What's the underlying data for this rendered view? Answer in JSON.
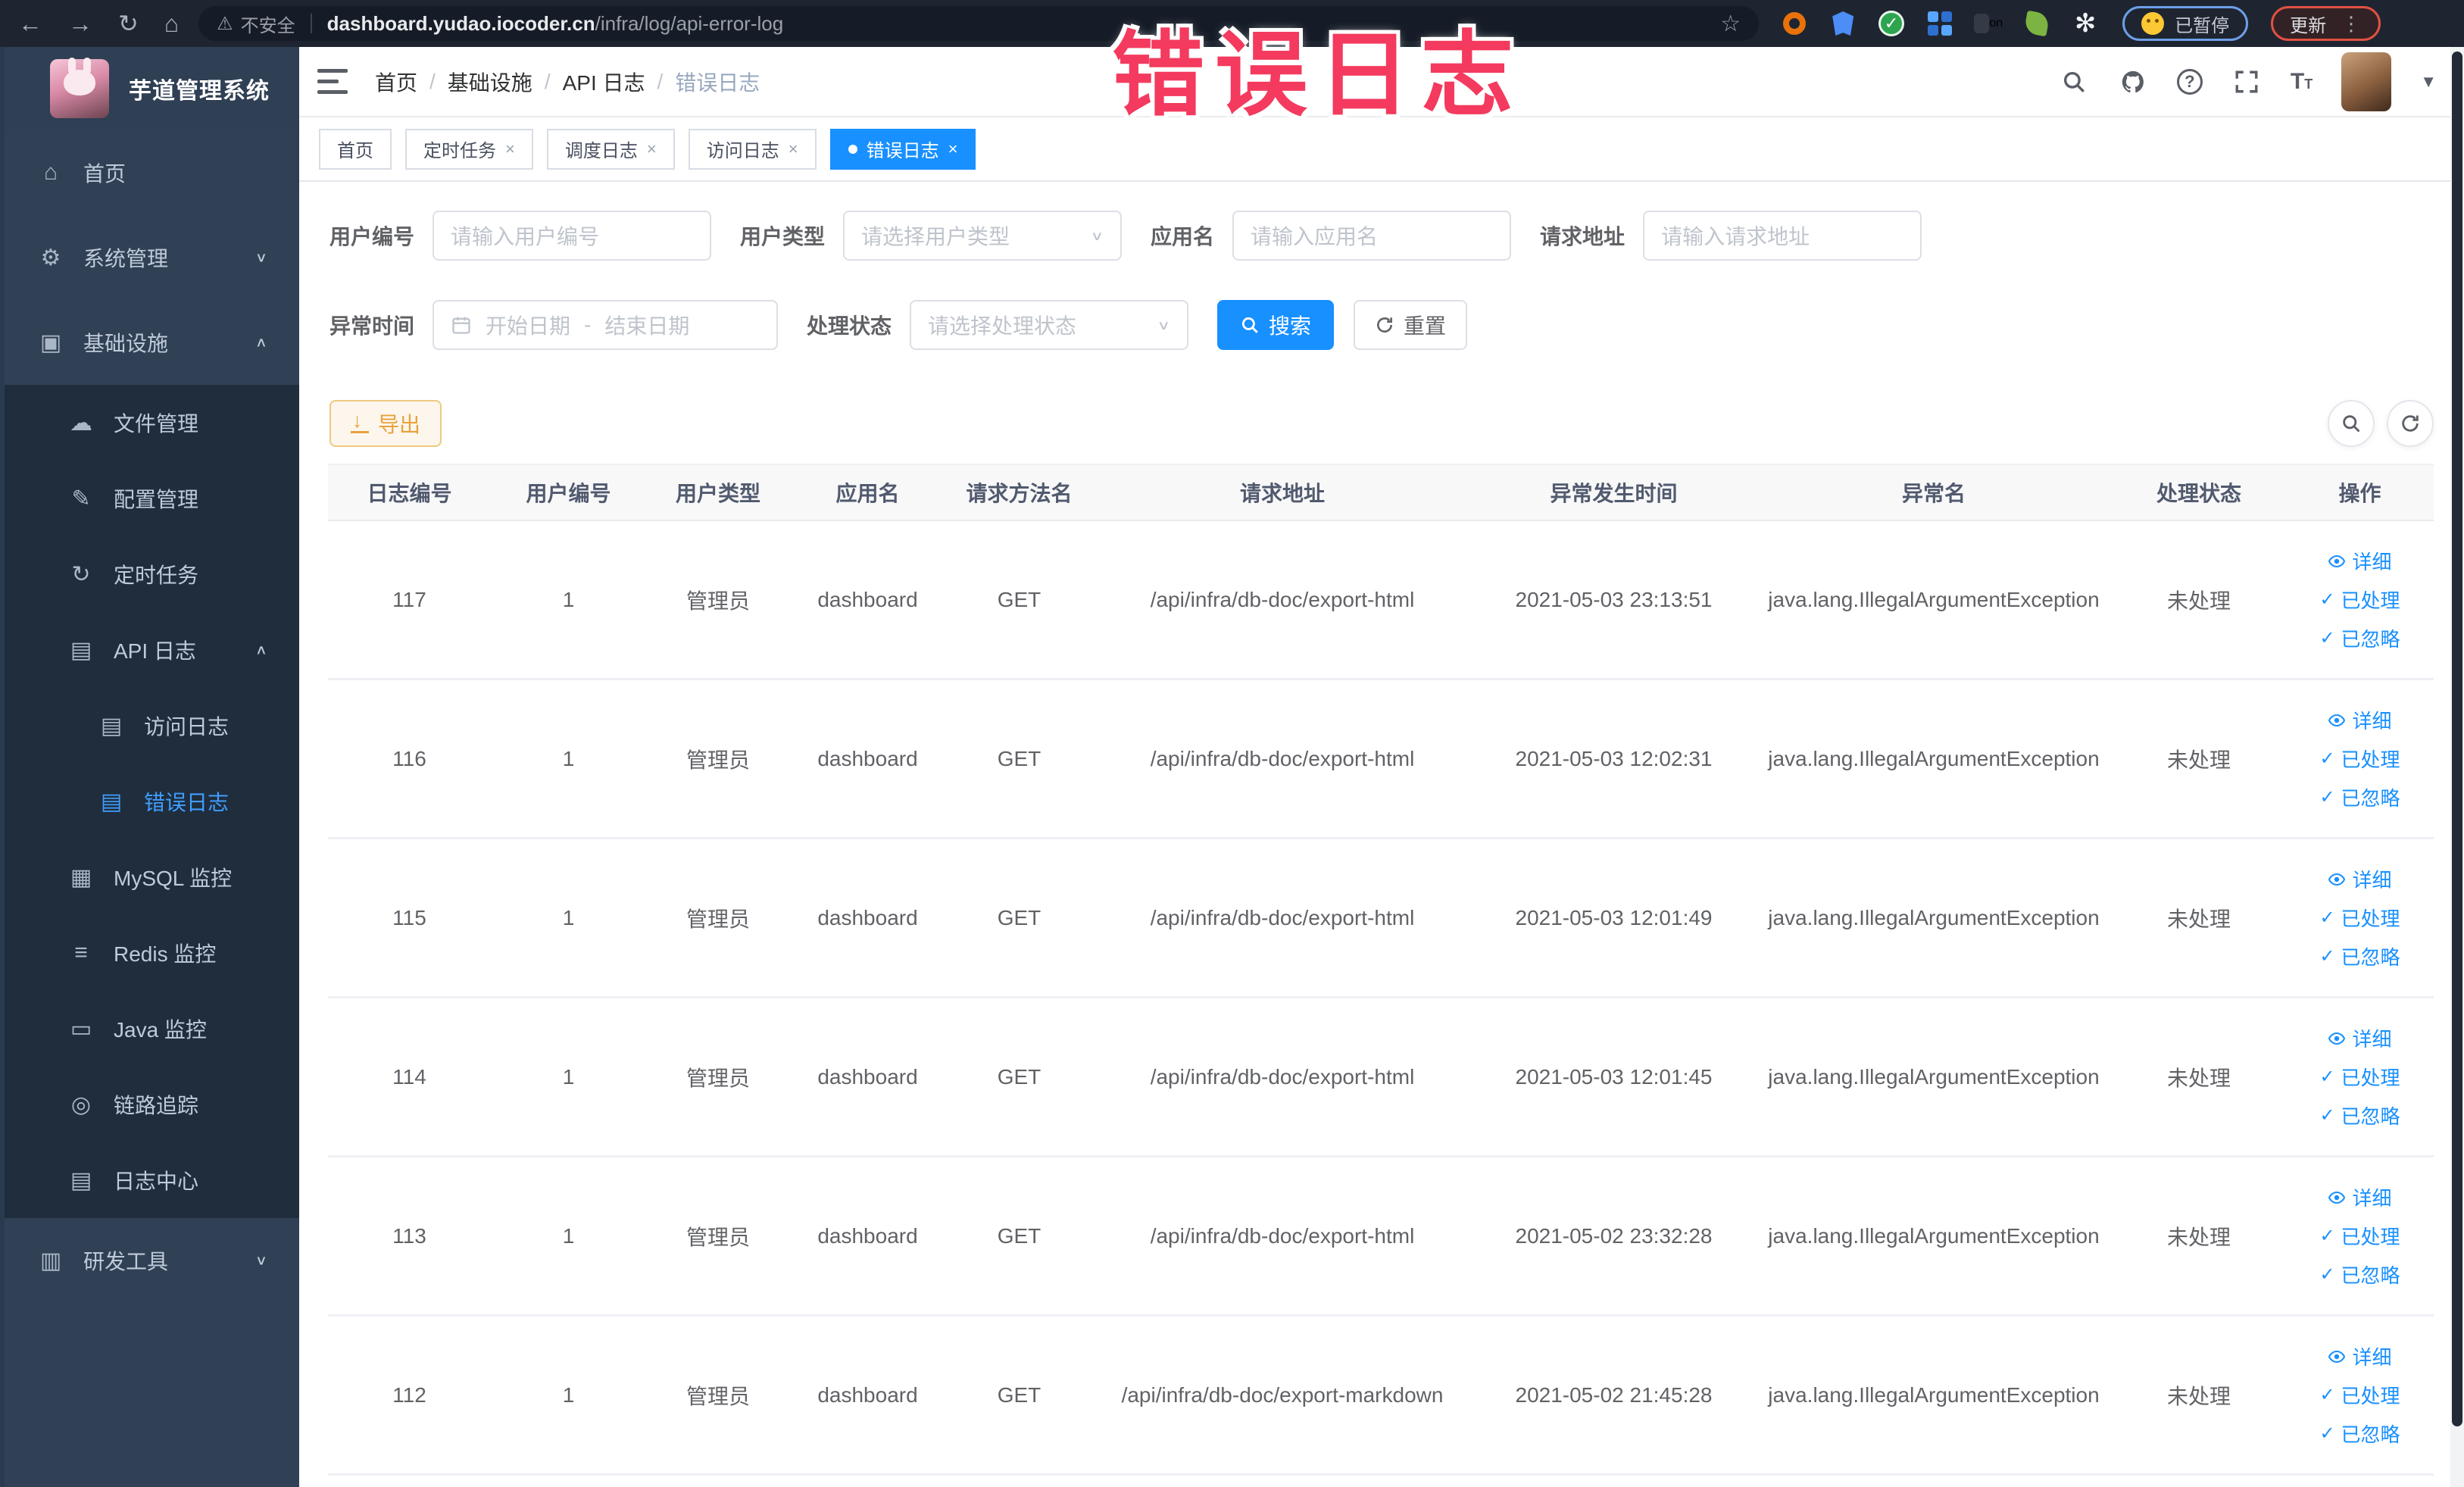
{
  "colors": {
    "accent": "#1890ff",
    "sidebar_bg": "#304156",
    "submenu_bg": "#1f2d3d",
    "active_link": "#409eff",
    "warning": "#e6a23c",
    "watermark": "#f43a5e"
  },
  "browser": {
    "back": "←",
    "forward": "→",
    "reload": "↻",
    "home": "⌂",
    "security_label": "不安全",
    "url_domain": "dashboard.yudao.iocoder.cn",
    "url_path": "/infra/log/api-error-log",
    "bookmark_star": "☆",
    "paused_badge": "已暂停",
    "update_button": "更新",
    "menu_dots": "⋮"
  },
  "watermark": "错误日志",
  "sidebar": {
    "title": "芋道管理系统",
    "items": [
      {
        "label": "首页",
        "level": 0,
        "icon": "⌂",
        "icon_name": "home-icon",
        "chevron": null,
        "dark": false,
        "active": false
      },
      {
        "label": "系统管理",
        "level": 0,
        "icon": "⚙",
        "icon_name": "gear-icon",
        "chevron": "∨",
        "dark": false,
        "active": false
      },
      {
        "label": "基础设施",
        "level": 0,
        "icon": "▣",
        "icon_name": "monitor-icon",
        "chevron": "∧",
        "dark": false,
        "active": false
      },
      {
        "label": "文件管理",
        "level": 1,
        "icon": "☁",
        "icon_name": "cloud-icon",
        "chevron": null,
        "dark": true,
        "active": false
      },
      {
        "label": "配置管理",
        "level": 1,
        "icon": "✎",
        "icon_name": "edit-icon",
        "chevron": null,
        "dark": true,
        "active": false
      },
      {
        "label": "定时任务",
        "level": 1,
        "icon": "↻",
        "icon_name": "timer-icon",
        "chevron": null,
        "dark": true,
        "active": false
      },
      {
        "label": "API 日志",
        "level": 1,
        "icon": "▤",
        "icon_name": "log-icon",
        "chevron": "∧",
        "dark": true,
        "active": false
      },
      {
        "label": "访问日志",
        "level": 2,
        "icon": "▤",
        "icon_name": "access-log-icon",
        "chevron": null,
        "dark": true,
        "active": false
      },
      {
        "label": "错误日志",
        "level": 2,
        "icon": "▤",
        "icon_name": "error-log-icon",
        "chevron": null,
        "dark": true,
        "active": true
      },
      {
        "label": "MySQL 监控",
        "level": 1,
        "icon": "▦",
        "icon_name": "mysql-icon",
        "chevron": null,
        "dark": true,
        "active": false
      },
      {
        "label": "Redis 监控",
        "level": 1,
        "icon": "≡",
        "icon_name": "redis-icon",
        "chevron": null,
        "dark": true,
        "active": false
      },
      {
        "label": "Java 监控",
        "level": 1,
        "icon": "▭",
        "icon_name": "java-icon",
        "chevron": null,
        "dark": true,
        "active": false
      },
      {
        "label": "链路追踪",
        "level": 1,
        "icon": "◎",
        "icon_name": "trace-icon",
        "chevron": null,
        "dark": true,
        "active": false
      },
      {
        "label": "日志中心",
        "level": 1,
        "icon": "▤",
        "icon_name": "log-center-icon",
        "chevron": null,
        "dark": true,
        "active": false
      },
      {
        "label": "研发工具",
        "level": 0,
        "icon": "▥",
        "icon_name": "toolbox-icon",
        "chevron": "∨",
        "dark": false,
        "active": false
      }
    ]
  },
  "navbar": {
    "breadcrumb": [
      "首页",
      "基础设施",
      "API 日志",
      "错误日志"
    ]
  },
  "tags": [
    {
      "label": "首页",
      "closable": false,
      "active": false
    },
    {
      "label": "定时任务",
      "closable": true,
      "active": false
    },
    {
      "label": "调度日志",
      "closable": true,
      "active": false
    },
    {
      "label": "访问日志",
      "closable": true,
      "active": false
    },
    {
      "label": "错误日志",
      "closable": true,
      "active": true
    }
  ],
  "filters": {
    "row1": [
      {
        "label": "用户编号",
        "placeholder": "请输入用户编号",
        "type": "input"
      },
      {
        "label": "用户类型",
        "placeholder": "请选择用户类型",
        "type": "select"
      },
      {
        "label": "应用名",
        "placeholder": "请输入应用名",
        "type": "input"
      },
      {
        "label": "请求地址",
        "placeholder": "请输入请求地址",
        "type": "input"
      }
    ],
    "time": {
      "label": "异常时间",
      "start_placeholder": "开始日期",
      "separator": "-",
      "end_placeholder": "结束日期"
    },
    "status": {
      "label": "处理状态",
      "placeholder": "请选择处理状态"
    },
    "search_label": "搜索",
    "reset_label": "重置"
  },
  "toolbar": {
    "export_label": "导出"
  },
  "table": {
    "columns": [
      "日志编号",
      "用户编号",
      "用户类型",
      "应用名",
      "请求方法名",
      "请求地址",
      "异常发生时间",
      "异常名",
      "处理状态",
      "操作"
    ],
    "actions": [
      "详细",
      "已处理",
      "已忽略"
    ],
    "rows": [
      {
        "id": "117",
        "user_id": "1",
        "user_type": "管理员",
        "app": "dashboard",
        "method": "GET",
        "url": "/api/infra/db-doc/export-html",
        "time": "2021-05-03 23:13:51",
        "exception": "java.lang.IllegalArgumentException",
        "status": "未处理"
      },
      {
        "id": "116",
        "user_id": "1",
        "user_type": "管理员",
        "app": "dashboard",
        "method": "GET",
        "url": "/api/infra/db-doc/export-html",
        "time": "2021-05-03 12:02:31",
        "exception": "java.lang.IllegalArgumentException",
        "status": "未处理"
      },
      {
        "id": "115",
        "user_id": "1",
        "user_type": "管理员",
        "app": "dashboard",
        "method": "GET",
        "url": "/api/infra/db-doc/export-html",
        "time": "2021-05-03 12:01:49",
        "exception": "java.lang.IllegalArgumentException",
        "status": "未处理"
      },
      {
        "id": "114",
        "user_id": "1",
        "user_type": "管理员",
        "app": "dashboard",
        "method": "GET",
        "url": "/api/infra/db-doc/export-html",
        "time": "2021-05-03 12:01:45",
        "exception": "java.lang.IllegalArgumentException",
        "status": "未处理"
      },
      {
        "id": "113",
        "user_id": "1",
        "user_type": "管理员",
        "app": "dashboard",
        "method": "GET",
        "url": "/api/infra/db-doc/export-html",
        "time": "2021-05-02 23:32:28",
        "exception": "java.lang.IllegalArgumentException",
        "status": "未处理"
      },
      {
        "id": "112",
        "user_id": "1",
        "user_type": "管理员",
        "app": "dashboard",
        "method": "GET",
        "url": "/api/infra/db-doc/export-markdown",
        "time": "2021-05-02 21:45:28",
        "exception": "java.lang.IllegalArgumentException",
        "status": "未处理"
      }
    ]
  }
}
